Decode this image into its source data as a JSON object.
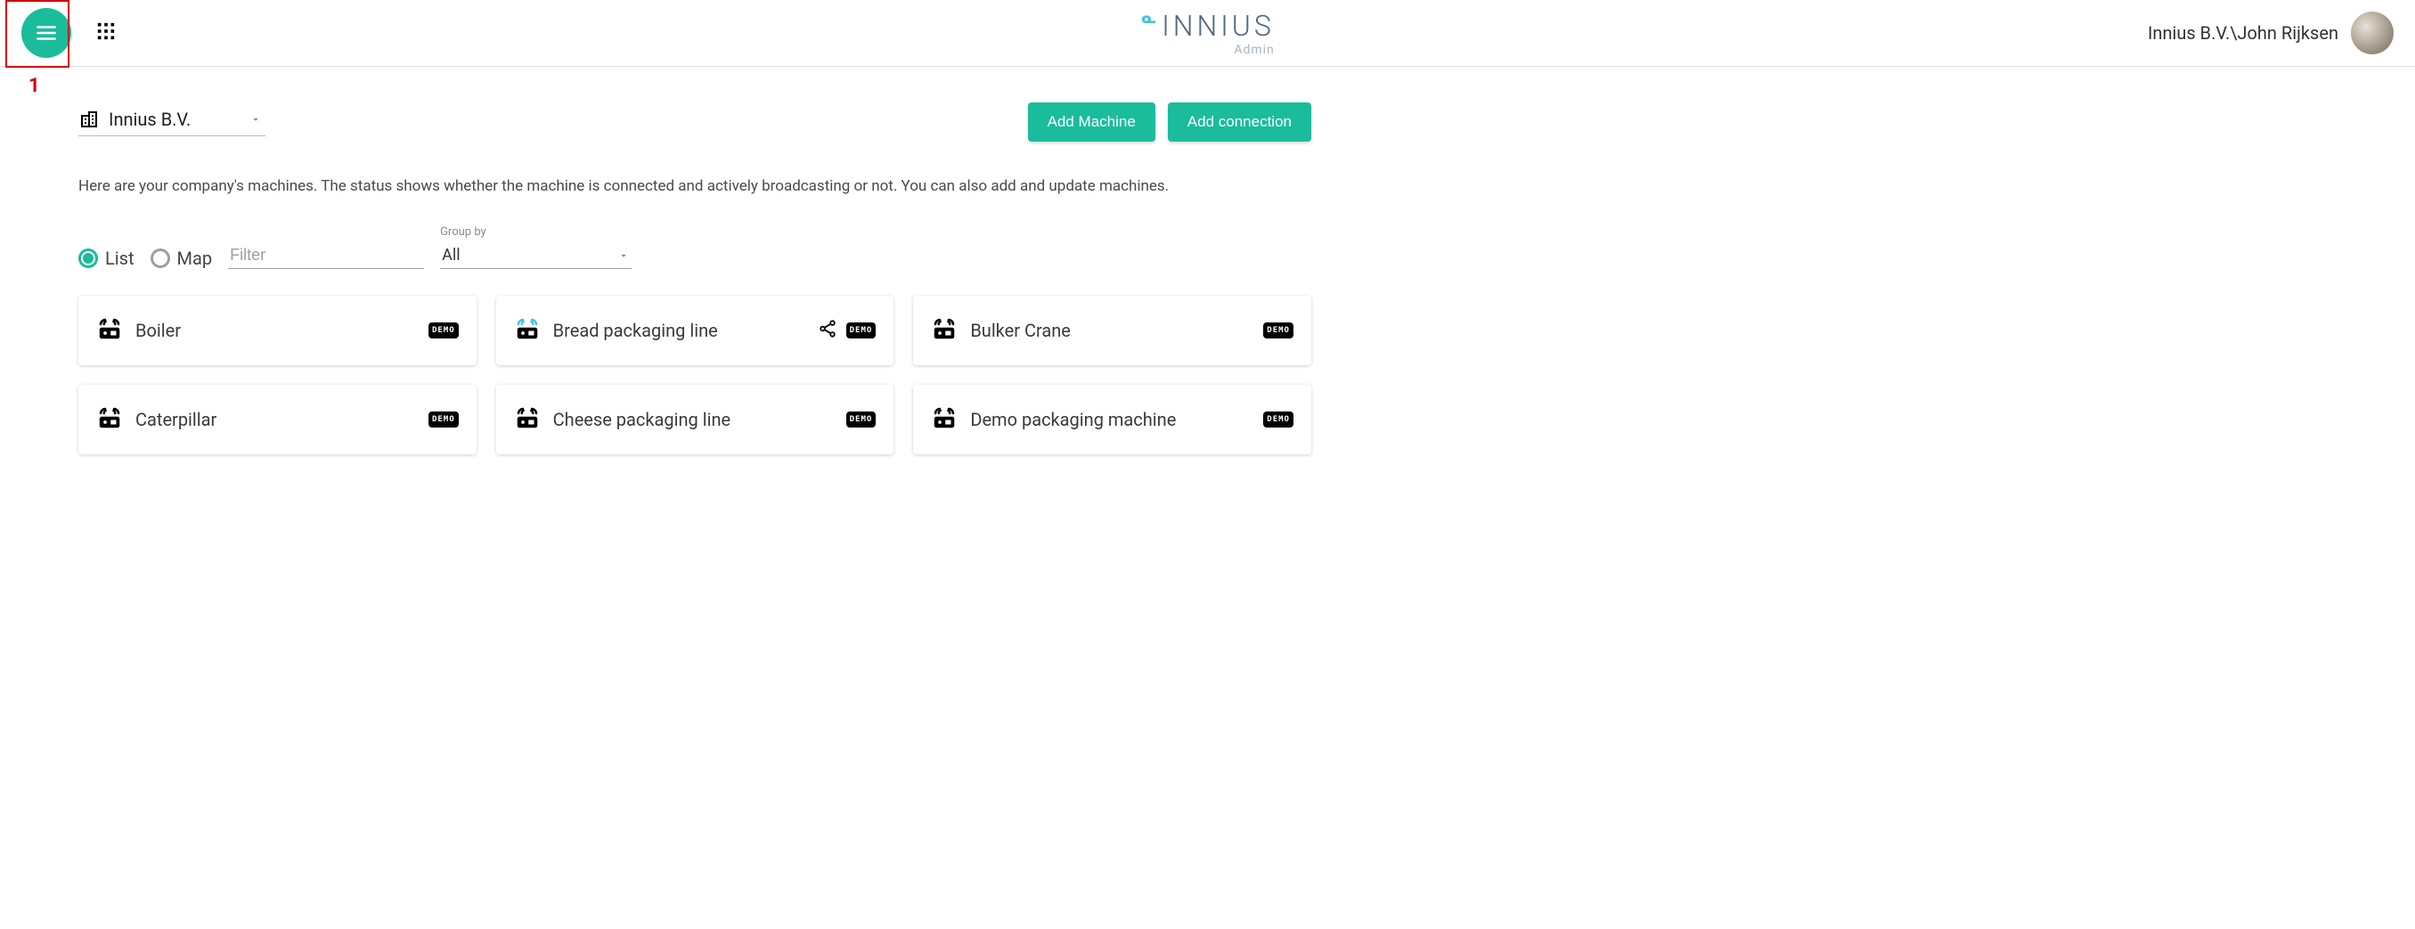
{
  "brand": {
    "logo_letter": "ᓐ",
    "name": "INNIUS",
    "sub": "Admin"
  },
  "user": {
    "label": "Innius B.V.\\John Rijksen"
  },
  "callout": {
    "number": "1"
  },
  "company": {
    "selected": "Innius B.V."
  },
  "buttons": {
    "add_machine": "Add Machine",
    "add_connection": "Add connection"
  },
  "intro_text": "Here are your company's machines. The status shows whether the machine is connected and actively broadcasting or not. You can also add and update machines.",
  "view": {
    "list": "List",
    "map": "Map"
  },
  "filter": {
    "placeholder": "Filter"
  },
  "groupby": {
    "label": "Group by",
    "value": "All"
  },
  "demo_label": "DEMO",
  "machines": [
    {
      "name": "Boiler",
      "broadcasting": false,
      "shared": false
    },
    {
      "name": "Bread packaging line",
      "broadcasting": true,
      "shared": true
    },
    {
      "name": "Bulker Crane",
      "broadcasting": false,
      "shared": false
    },
    {
      "name": "Caterpillar",
      "broadcasting": false,
      "shared": false
    },
    {
      "name": "Cheese packaging line",
      "broadcasting": false,
      "shared": false
    },
    {
      "name": "Demo packaging machine",
      "broadcasting": false,
      "shared": false
    }
  ]
}
